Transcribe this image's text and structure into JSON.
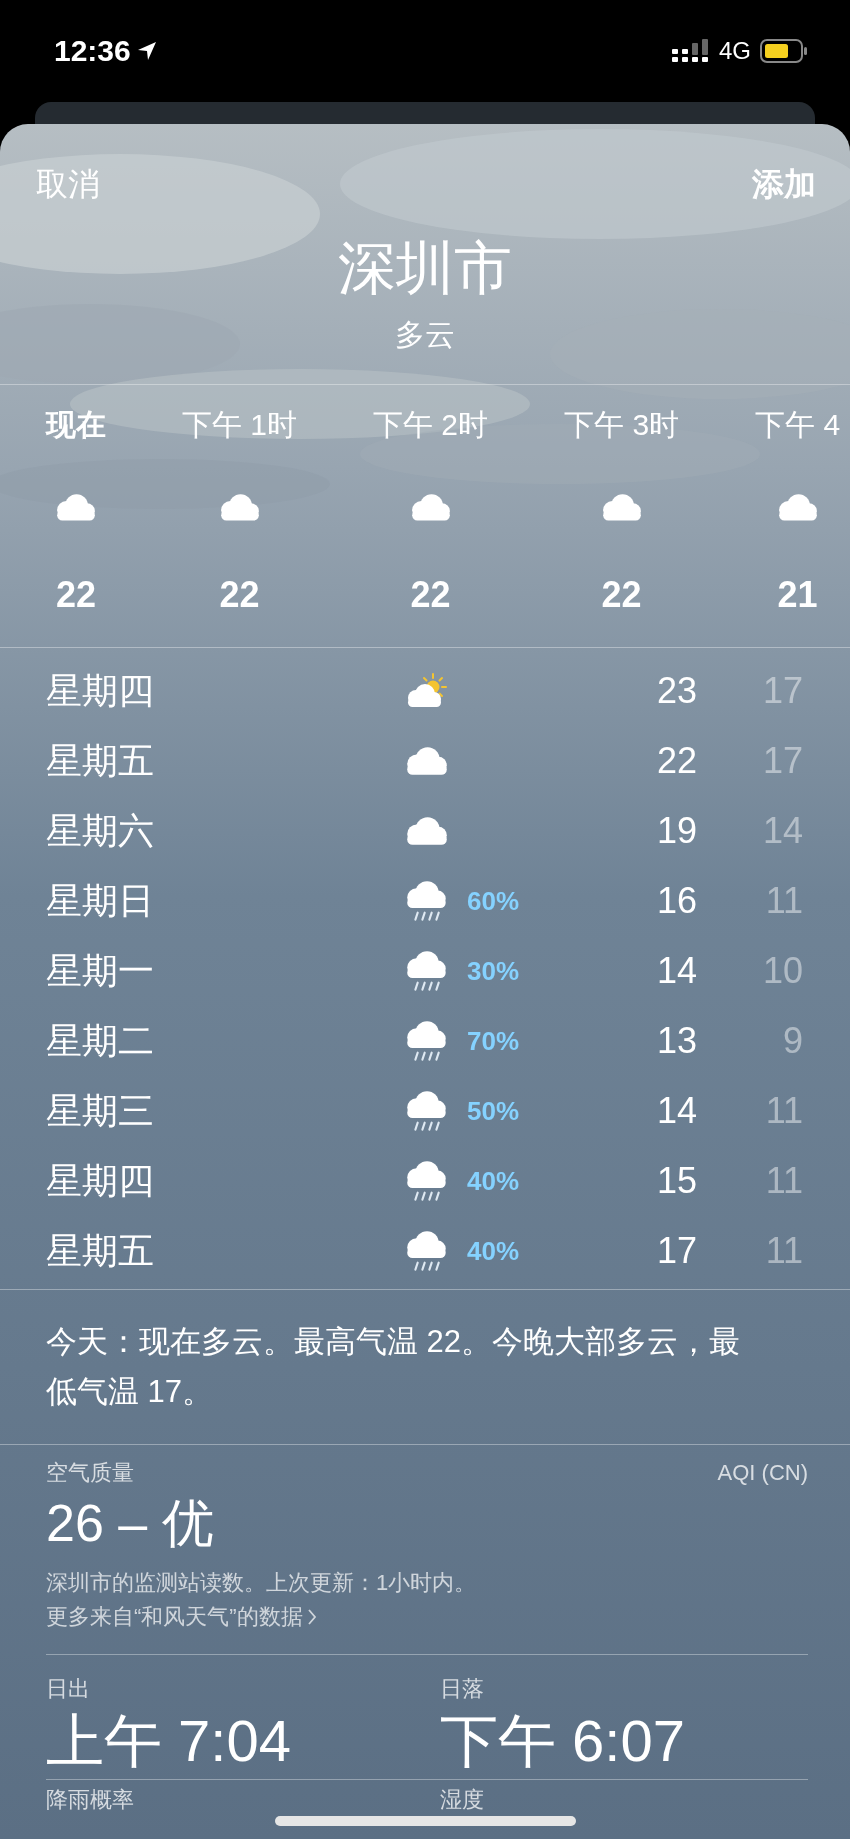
{
  "status_bar": {
    "time": "12:36",
    "network": "4G"
  },
  "nav": {
    "cancel": "取消",
    "add": "添加"
  },
  "location": {
    "city": "深圳市",
    "condition": "多云"
  },
  "hourly": [
    {
      "label": "现在",
      "kind": "cloudy",
      "temp": "22",
      "current": true
    },
    {
      "label": "下午 1时",
      "kind": "cloudy",
      "temp": "22",
      "current": false
    },
    {
      "label": "下午 2时",
      "kind": "cloudy",
      "temp": "22",
      "current": false
    },
    {
      "label": "下午 3时",
      "kind": "cloudy",
      "temp": "22",
      "current": false
    },
    {
      "label": "下午 4",
      "kind": "cloudy",
      "temp": "21",
      "current": false
    }
  ],
  "daily": [
    {
      "day": "星期四",
      "kind": "partly_sunny",
      "high": "23",
      "low": "17"
    },
    {
      "day": "星期五",
      "kind": "cloudy",
      "high": "22",
      "low": "17"
    },
    {
      "day": "星期六",
      "kind": "cloudy",
      "high": "19",
      "low": "14"
    },
    {
      "day": "星期日",
      "kind": "rain",
      "precip": "60%",
      "high": "16",
      "low": "11"
    },
    {
      "day": "星期一",
      "kind": "rain",
      "precip": "30%",
      "high": "14",
      "low": "10"
    },
    {
      "day": "星期二",
      "kind": "rain",
      "precip": "70%",
      "high": "13",
      "low": "9"
    },
    {
      "day": "星期三",
      "kind": "rain",
      "precip": "50%",
      "high": "14",
      "low": "11"
    },
    {
      "day": "星期四",
      "kind": "rain",
      "precip": "40%",
      "high": "15",
      "low": "11"
    },
    {
      "day": "星期五",
      "kind": "rain",
      "precip": "40%",
      "high": "17",
      "low": "11"
    }
  ],
  "summary": "今天：现在多云。最高气温 22。今晚大部多云，最低气温 17。",
  "air_quality": {
    "label": "空气质量",
    "scale": "AQI (CN)",
    "value": "26 – 优",
    "note": "深圳市的监测站读数。上次更新：1小时内。",
    "link": "更多来自“和风天气”的数据"
  },
  "details": [
    {
      "label": "日出",
      "value": "上午 7:04"
    },
    {
      "label": "日落",
      "value": "下午 6:07"
    },
    {
      "label": "降雨概率"
    },
    {
      "label": "湿度"
    }
  ]
}
